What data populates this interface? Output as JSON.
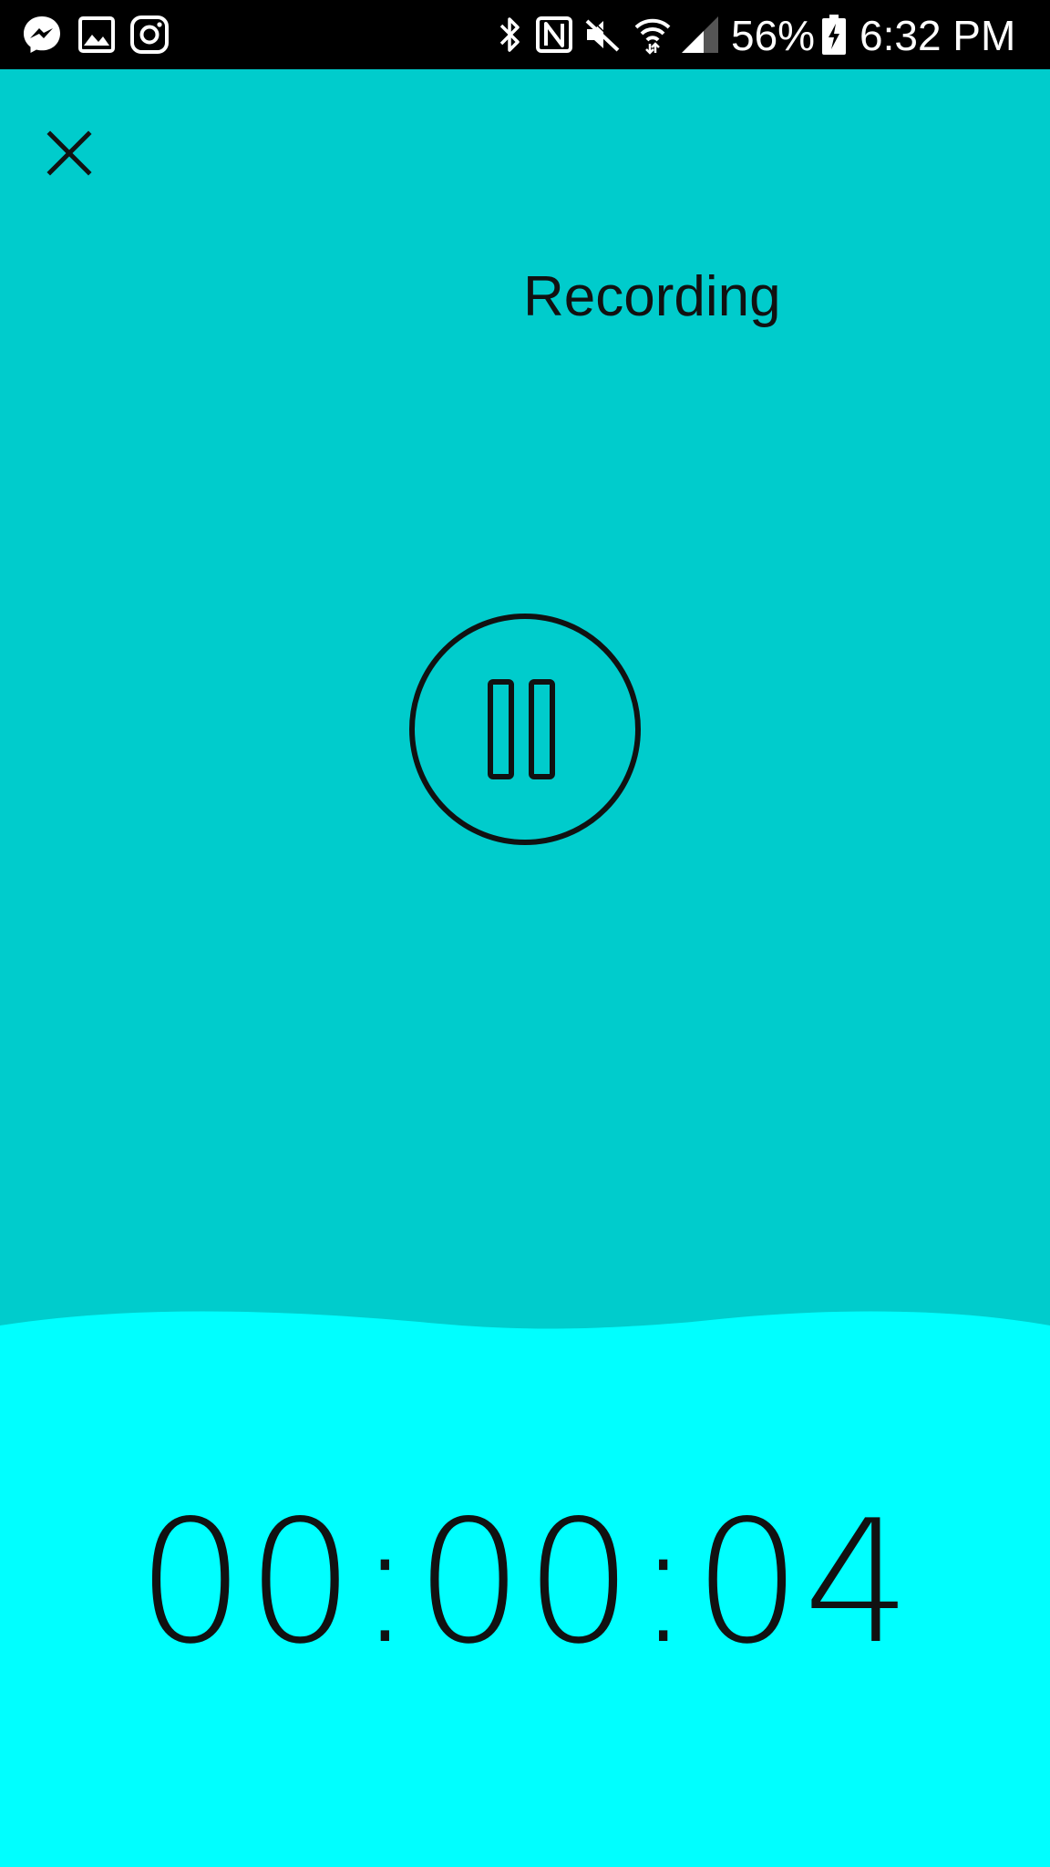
{
  "status_bar": {
    "battery_text": "56%",
    "time": "6:32 PM",
    "left_icons": [
      "messenger-icon",
      "gallery-icon",
      "instagram-icon"
    ],
    "right_icons": [
      "bluetooth-icon",
      "nfc-icon",
      "mute-icon",
      "wifi-icon",
      "signal-icon",
      "battery-charging-icon"
    ]
  },
  "header": {
    "close_icon": "close-icon",
    "title": "Recording"
  },
  "controls": {
    "pause_icon": "pause-icon"
  },
  "timer": {
    "elapsed": "00:00:04"
  },
  "colors": {
    "status_bar_bg": "#000000",
    "main_bg": "#00cccc",
    "wave_bg": "#00ffff",
    "foreground": "#111111"
  }
}
